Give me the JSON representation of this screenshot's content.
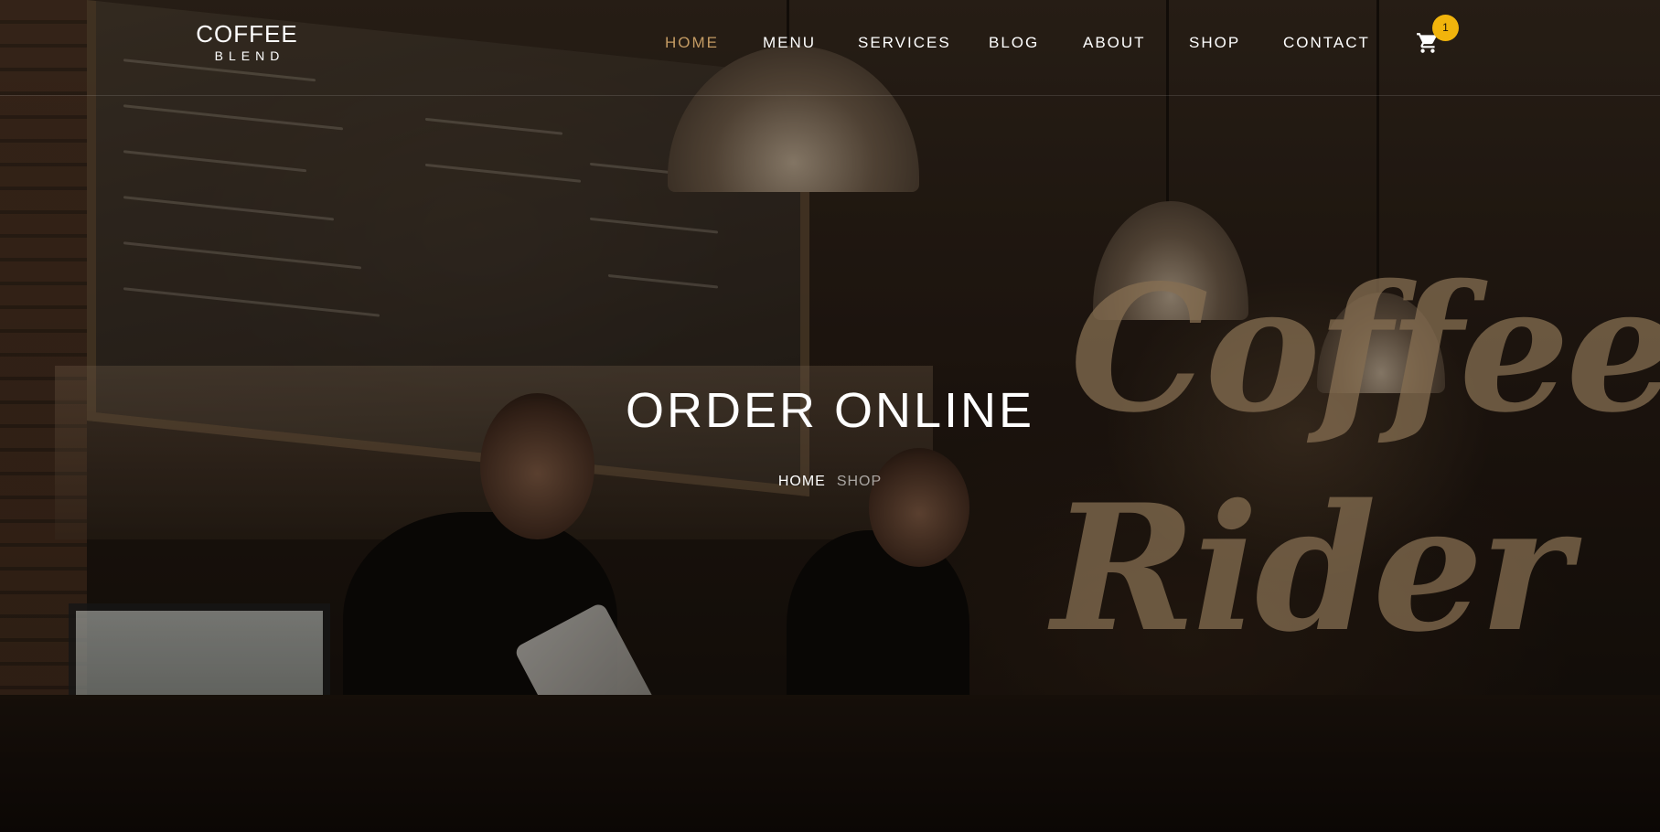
{
  "brand": {
    "top": "COFFEE",
    "bottom": "BLEND"
  },
  "nav": {
    "items": [
      {
        "label": "HOME",
        "active": true
      },
      {
        "label": "MENU",
        "active": false
      },
      {
        "label": "SERVICES",
        "active": false
      },
      {
        "label": "BLOG",
        "active": false
      },
      {
        "label": "ABOUT",
        "active": false
      },
      {
        "label": "SHOP",
        "active": false
      },
      {
        "label": "CONTACT",
        "active": false
      }
    ],
    "cart_icon": "shopping-cart-icon",
    "cart_count": "1"
  },
  "hero": {
    "title": "ORDER ONLINE",
    "breadcrumb": {
      "home": "HOME",
      "current": "SHOP"
    }
  },
  "colors": {
    "accent": "#c49b63",
    "badge": "#f1b40c",
    "text": "#ffffff"
  }
}
